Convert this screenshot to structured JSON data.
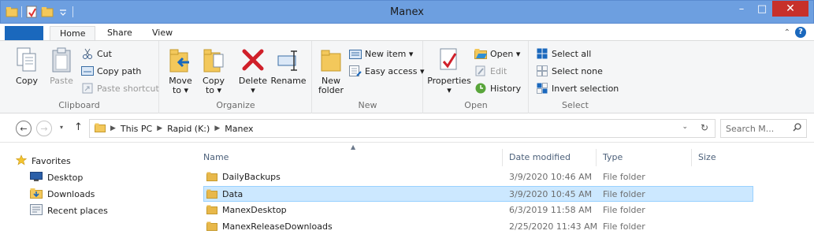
{
  "window": {
    "title": "Manex",
    "controls": {
      "minimize": "–",
      "maximize": "□",
      "close": "✕"
    }
  },
  "ribbon": {
    "tabs": [
      {
        "label": "Home",
        "active": true
      },
      {
        "label": "Share",
        "active": false
      },
      {
        "label": "View",
        "active": false
      }
    ],
    "groups": {
      "clipboard": {
        "label": "Clipboard",
        "copy": "Copy",
        "paste": "Paste",
        "cut": "Cut",
        "copy_path": "Copy path",
        "paste_shortcut": "Paste shortcut"
      },
      "organize": {
        "label": "Organize",
        "move_to": "Move",
        "move_to_2": "to ▾",
        "copy_to": "Copy",
        "copy_to_2": "to ▾",
        "delete": "Delete",
        "delete_2": "▾",
        "rename": "Rename"
      },
      "new": {
        "label": "New",
        "new_folder": "New",
        "new_folder_2": "folder",
        "new_item": "New item ▾",
        "easy_access": "Easy access ▾"
      },
      "open": {
        "label": "Open",
        "properties": "Properties",
        "properties_2": "▾",
        "open": "Open ▾",
        "edit": "Edit",
        "history": "History"
      },
      "select": {
        "label": "Select",
        "select_all": "Select all",
        "select_none": "Select none",
        "invert": "Invert selection"
      }
    }
  },
  "address": {
    "crumbs": [
      "This PC",
      "Rapid (K:)",
      "Manex"
    ],
    "search_placeholder": "Search M..."
  },
  "nav_pane": {
    "favorites": "Favorites",
    "items": [
      "Desktop",
      "Downloads",
      "Recent places"
    ]
  },
  "file_list": {
    "columns": [
      "Name",
      "Date modified",
      "Type",
      "Size"
    ],
    "rows": [
      {
        "name": "DailyBackups",
        "date": "3/9/2020 10:46 AM",
        "type": "File folder",
        "selected": false
      },
      {
        "name": "Data",
        "date": "3/9/2020 10:45 AM",
        "type": "File folder",
        "selected": true
      },
      {
        "name": "ManexDesktop",
        "date": "6/3/2019 11:58 AM",
        "type": "File folder",
        "selected": false
      },
      {
        "name": "ManexReleaseDownloads",
        "date": "2/25/2020 11:43 AM",
        "type": "File folder",
        "selected": false
      }
    ]
  },
  "colors": {
    "titlebar": "#6d9fe0",
    "file_tab": "#1a68bd",
    "close_button": "#c7302a",
    "selection": "#cce8ff",
    "folder": "#e8b84a"
  }
}
